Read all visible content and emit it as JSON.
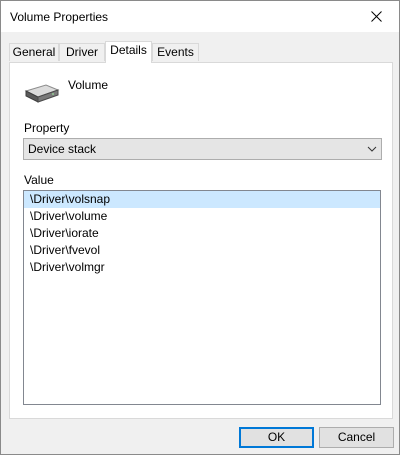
{
  "window": {
    "title": "Volume Properties"
  },
  "tabs": [
    {
      "label": "General"
    },
    {
      "label": "Driver"
    },
    {
      "label": "Details"
    },
    {
      "label": "Events"
    }
  ],
  "active_tab": "Details",
  "device": {
    "name": "Volume",
    "icon": "drive-icon"
  },
  "property": {
    "label": "Property",
    "selected": "Device stack"
  },
  "value": {
    "label": "Value",
    "items": [
      "\\Driver\\volsnap",
      "\\Driver\\volume",
      "\\Driver\\iorate",
      "\\Driver\\fvevol",
      "\\Driver\\volmgr"
    ],
    "selected_index": 0
  },
  "buttons": {
    "ok": "OK",
    "cancel": "Cancel"
  },
  "colors": {
    "selection": "#cce8ff",
    "default_button_border": "#0078d7",
    "window_background": "#f0f0f0"
  }
}
